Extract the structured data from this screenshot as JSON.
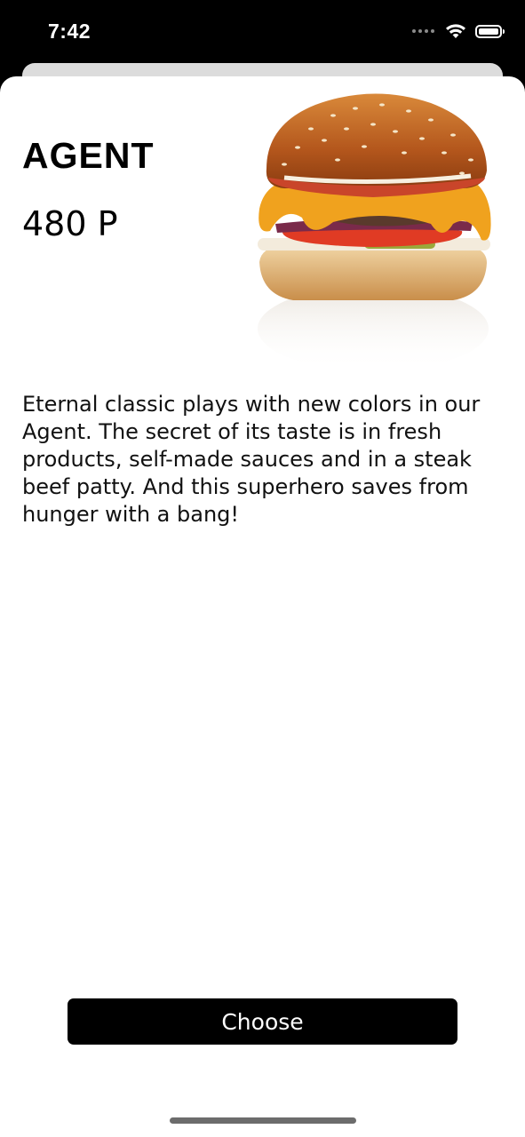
{
  "status_bar": {
    "time": "7:42"
  },
  "product": {
    "name": "AGENT",
    "price": "480 P",
    "image_icon": "burger-image",
    "description": "Eternal classic plays with new colors in our Agent. The secret of its taste is in fresh products, self-made sauces and in a steak beef patty. And this superhero saves from hunger with a bang!"
  },
  "actions": {
    "choose_label": "Choose"
  },
  "colors": {
    "button_bg": "#000000",
    "sheet_bg": "#ffffff"
  }
}
